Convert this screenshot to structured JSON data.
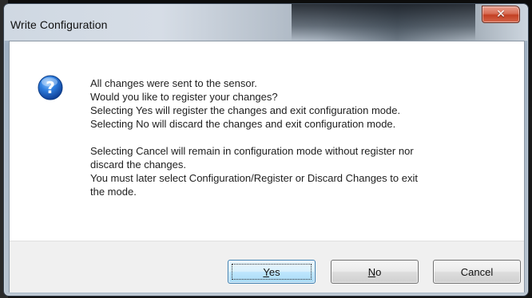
{
  "window": {
    "title": "Write Configuration"
  },
  "icons": {
    "dialog_icon": "question-icon",
    "close_glyph": "✕"
  },
  "message": {
    "lines": [
      "All changes were sent to the sensor.",
      "Would you like to register your changes?",
      "Selecting Yes will register the changes and exit configuration mode.",
      "Selecting No will discard the changes and exit configuration mode.",
      "",
      "Selecting Cancel will remain in configuration mode without register nor",
      "discard the changes.",
      "You must later select Configuration/Register or Discard Changes to exit",
      "the mode."
    ]
  },
  "buttons": {
    "yes": {
      "mnemonic": "Y",
      "rest": "es"
    },
    "no": {
      "mnemonic": "N",
      "rest": "o"
    },
    "cancel": {
      "label": "Cancel"
    }
  },
  "colors": {
    "close_button": "#c23f23",
    "default_button_border": "#3c7fb1",
    "icon_blue": "#1f5fb8"
  }
}
